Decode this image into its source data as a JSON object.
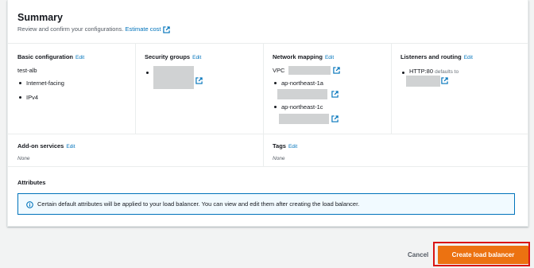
{
  "summary": {
    "title": "Summary",
    "subtitle": "Review and confirm your configurations.",
    "estimate_link": "Estimate cost"
  },
  "basic": {
    "heading": "Basic configuration",
    "edit": "Edit",
    "name": "test-alb",
    "items": [
      "Internet-facing",
      "IPv4"
    ]
  },
  "security": {
    "heading": "Security groups",
    "edit": "Edit"
  },
  "network": {
    "heading": "Network mapping",
    "edit": "Edit",
    "vpc_label": "VPC",
    "zones": [
      "ap-northeast-1a",
      "ap-northeast-1c"
    ]
  },
  "listeners": {
    "heading": "Listeners and routing",
    "edit": "Edit",
    "protocol": "HTTP:80",
    "defaults_to": "defaults to"
  },
  "addon": {
    "heading": "Add-on services",
    "edit": "Edit",
    "value": "None"
  },
  "tags": {
    "heading": "Tags",
    "edit": "Edit",
    "value": "None"
  },
  "attributes": {
    "heading": "Attributes",
    "info": "Certain default attributes will be applied to your load balancer. You can view and edit them after creating the load balancer."
  },
  "footer": {
    "cancel": "Cancel",
    "create": "Create load balancer"
  }
}
